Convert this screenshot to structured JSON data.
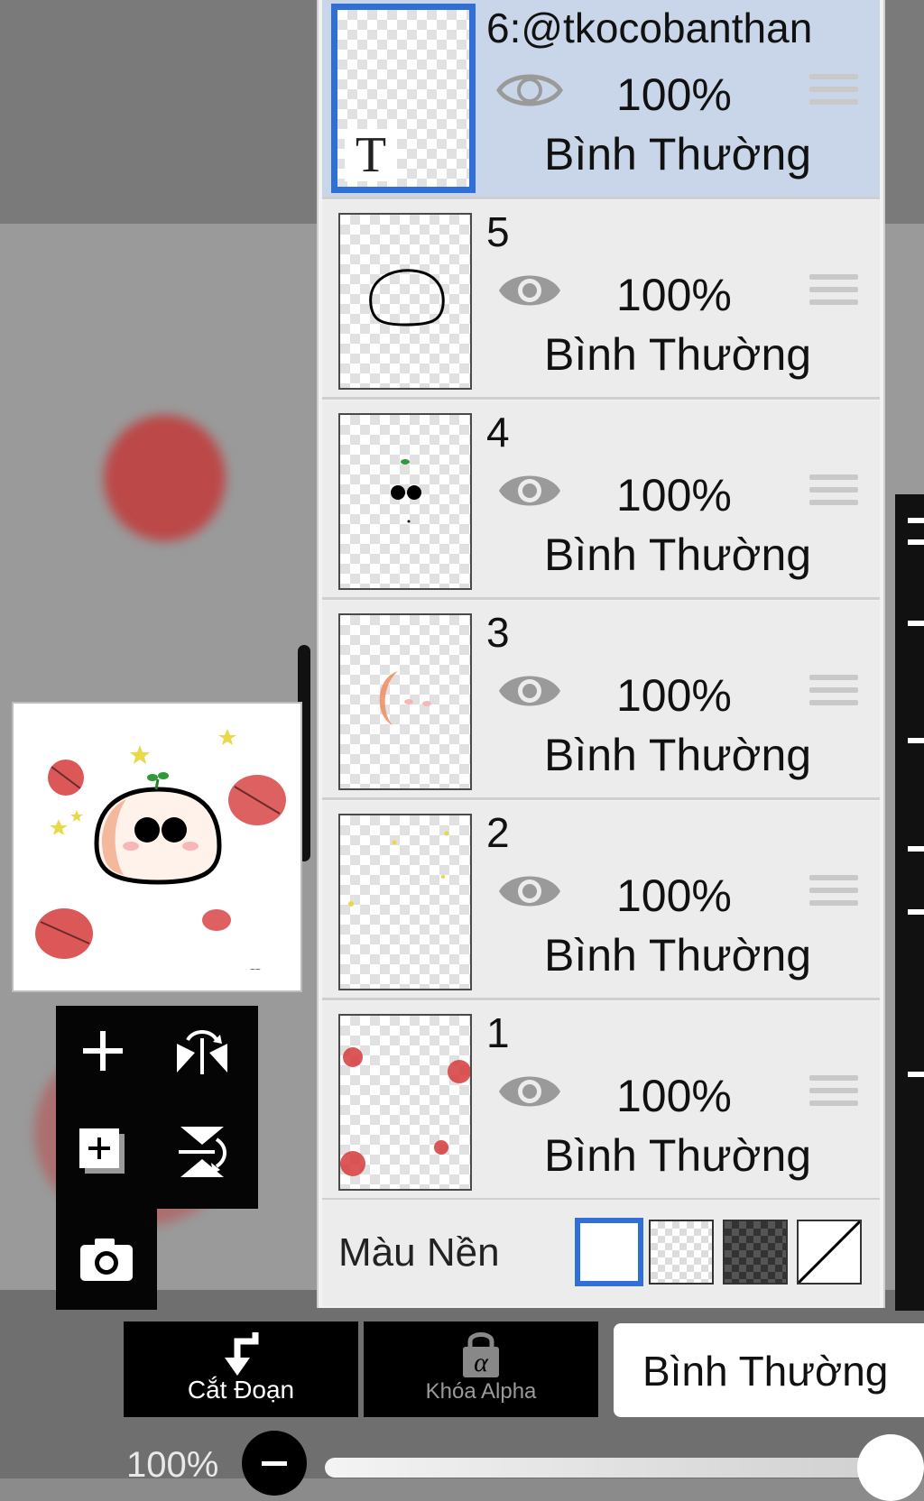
{
  "layers": [
    {
      "name": "6:@tkocobanthan",
      "opacity": "100%",
      "blend": "Bình Thường",
      "selected": true,
      "thumb_text": "T"
    },
    {
      "name": "5",
      "opacity": "100%",
      "blend": "Bình Thường",
      "selected": false
    },
    {
      "name": "4",
      "opacity": "100%",
      "blend": "Bình Thường",
      "selected": false
    },
    {
      "name": "3",
      "opacity": "100%",
      "blend": "Bình Thường",
      "selected": false
    },
    {
      "name": "2",
      "opacity": "100%",
      "blend": "Bình Thường",
      "selected": false
    },
    {
      "name": "1",
      "opacity": "100%",
      "blend": "Bình Thường",
      "selected": false
    }
  ],
  "background": {
    "label": "Màu Nền",
    "selected": "white",
    "options": [
      "white",
      "checker-light",
      "checker-dark",
      "none"
    ]
  },
  "actions": {
    "add_layer": "plus-icon",
    "flip_horizontal": "flip-horizontal-icon",
    "duplicate_layer": "duplicate-icon",
    "flip_vertical": "flip-vertical-icon",
    "camera": "camera-icon"
  },
  "bottom": {
    "clip_label": "Cắt Đoạn",
    "alpha_lock_label": "Khóa Alpha",
    "alpha_lock_glyph": "α",
    "blend_mode": "Bình Thường",
    "opacity_label": "100%",
    "opacity_value": 1.0
  },
  "colors": {
    "selection_blue": "#2f6fd6",
    "selected_row": "#c9d6ea",
    "panel": "#ececec"
  }
}
